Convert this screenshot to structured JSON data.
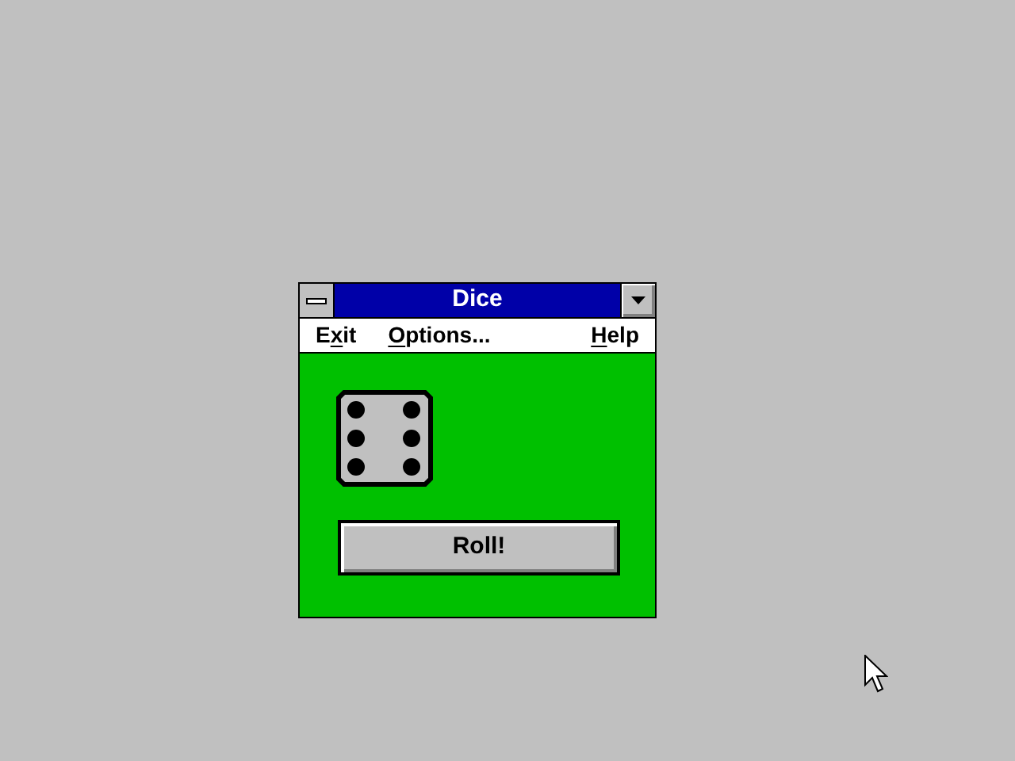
{
  "window": {
    "title": "Dice"
  },
  "menu": [
    {
      "kind": "start",
      "before": "E",
      "key": "x",
      "after": "it"
    },
    {
      "kind": "start",
      "key": "O",
      "after": "ptions..."
    },
    {
      "kind": "end",
      "key": "H",
      "after": "elp"
    }
  ],
  "die": {
    "kind": "six"
  },
  "button": {
    "label": "Roll!"
  }
}
